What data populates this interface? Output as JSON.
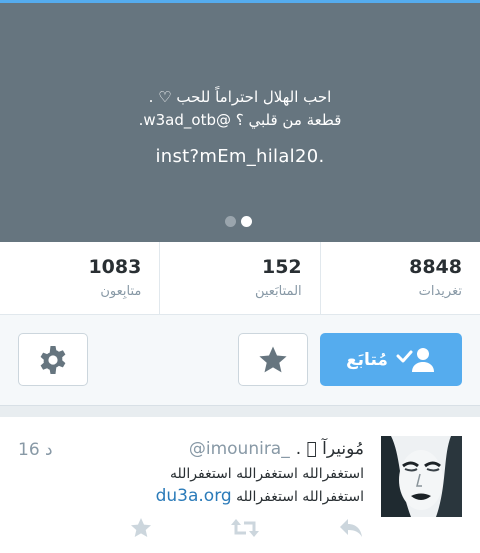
{
  "header": {
    "bio_line1": "احب الهلال احتراماً للحب ♡ .",
    "bio_line2": "قطعة من قلبي ؟ @w3ad_otb.",
    "bio_line3": "inst?mEm_hilal20."
  },
  "stats": [
    {
      "value": "1083",
      "label": "متابِعون"
    },
    {
      "value": "152",
      "label": "المتابَعين"
    },
    {
      "value": "8848",
      "label": "تغريدات"
    }
  ],
  "actions": {
    "follow_label": "مُتابَع"
  },
  "tweet": {
    "name": "مُونيرآ ⃞ .",
    "handle": "_imounira@",
    "time": "16 د",
    "text_line1": "استغفرالله استغفرالله استغفرالله",
    "text_line2": "استغفرالله استغفرالله",
    "link": "du3a.org"
  },
  "colors": {
    "accent": "#55acee",
    "header_bg": "#66757f",
    "link": "#2b7bb9"
  }
}
